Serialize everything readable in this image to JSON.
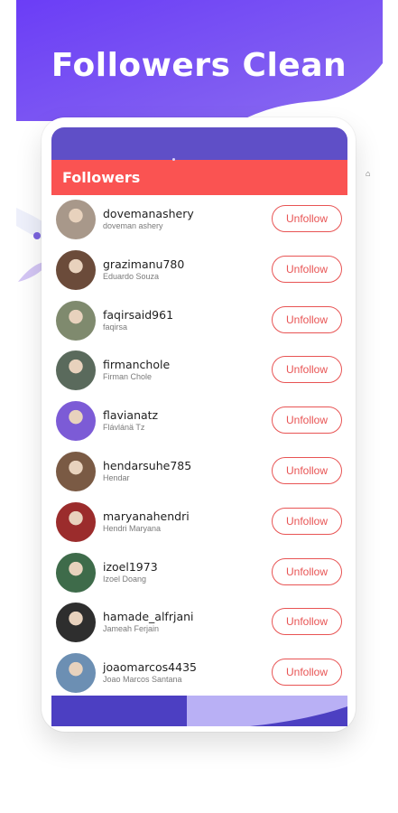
{
  "promo": {
    "headline": "Followers Clean"
  },
  "app": {
    "title": "Followers",
    "action_label": "Unfollow"
  },
  "followers": [
    {
      "username": "dovemanashery",
      "fullname": "doveman ashery",
      "avatar_color": "#a8988a"
    },
    {
      "username": "grazimanu780",
      "fullname": "Eduardo Souza",
      "avatar_color": "#6b4b3a"
    },
    {
      "username": "faqirsaid961",
      "fullname": "faqirsa",
      "avatar_color": "#7f8a6e"
    },
    {
      "username": "firmanchole",
      "fullname": "Firman Chole",
      "avatar_color": "#5a6a5c"
    },
    {
      "username": "flavianatz",
      "fullname": "Flávlánä Tz",
      "avatar_color": "#7c5bd6"
    },
    {
      "username": "hendarsuhe785",
      "fullname": "Hendar",
      "avatar_color": "#7a5a44"
    },
    {
      "username": "maryanahendri",
      "fullname": "Hendri Maryana",
      "avatar_color": "#9b2c2c"
    },
    {
      "username": "izoel1973",
      "fullname": "Izoel Doang",
      "avatar_color": "#3e6b4a"
    },
    {
      "username": "hamade_alfrjani",
      "fullname": "Jameah Ferjain",
      "avatar_color": "#2e2e2e"
    },
    {
      "username": "joaomarcos4435",
      "fullname": "Joao Marcos Santana",
      "avatar_color": "#6c8fb3"
    }
  ],
  "colors": {
    "purple_top": "#6a3cf5",
    "purple_mid": "#7b5bf2",
    "app_bar_red": "#fa5352",
    "status_purple": "#5f4fc7",
    "unfollow_red": "#e85454"
  },
  "icons": [
    "feather-icon",
    "dot-icon",
    "home-icon"
  ]
}
